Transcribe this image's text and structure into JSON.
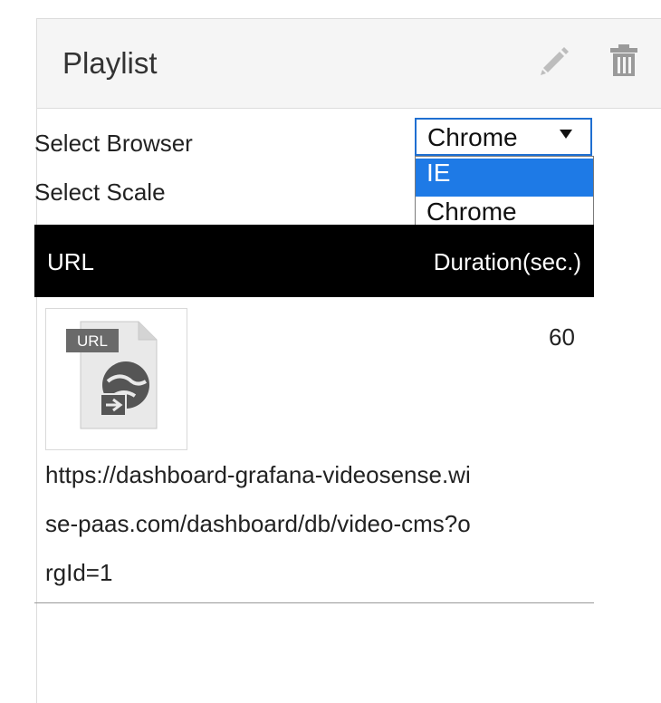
{
  "panel": {
    "title": "Playlist",
    "edit_icon": "pencil-icon",
    "delete_icon": "trash-icon"
  },
  "form": {
    "browser_label": "Select Browser",
    "scale_label": "Select Scale",
    "browser_select": {
      "value": "Chrome",
      "options": [
        "IE",
        "Chrome"
      ],
      "highlighted": "IE"
    }
  },
  "table": {
    "headers": [
      "URL",
      "Duration(sec.)"
    ],
    "rows": [
      {
        "thumbnail_label": "URL",
        "thumbnail_icon": "url-file-icon",
        "duration": "60",
        "url_lines": [
          "https://dashboard-grafana-videosense.wi",
          "se-paas.com/dashboard/db/video-cms?o",
          "rgId=1"
        ]
      }
    ]
  },
  "colors": {
    "header_bg": "#f5f5f5",
    "table_head_bg": "#000000",
    "highlight": "#1e7ae6",
    "select_border": "#1f6fd1"
  }
}
